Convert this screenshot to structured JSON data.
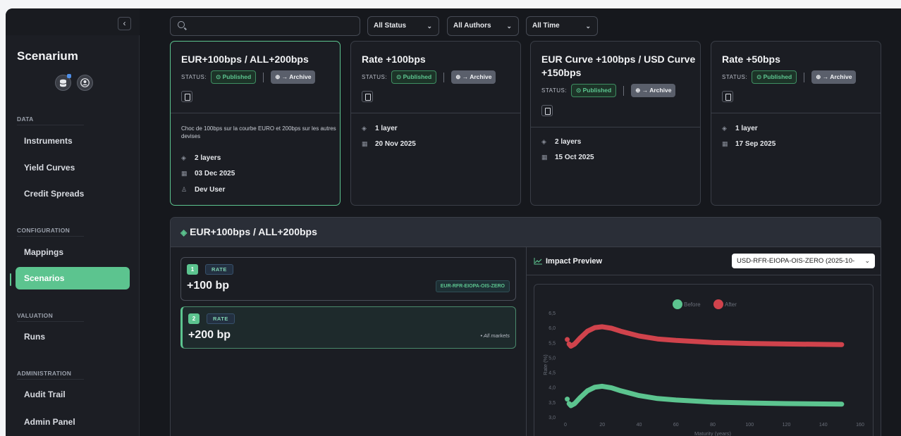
{
  "sidebar": {
    "collapse": "‹",
    "brand": "Scenarium",
    "sections": [
      {
        "title": "DATA",
        "items": [
          "Instruments",
          "Yield Curves",
          "Credit Spreads"
        ]
      },
      {
        "title": "CONFIGURATION",
        "items": [
          "Mappings",
          "Scenarios"
        ]
      },
      {
        "title": "VALUATION",
        "items": [
          "Runs"
        ]
      },
      {
        "title": "ADMINISTRATION",
        "items": [
          "Audit Trail",
          "Admin Panel"
        ]
      }
    ],
    "active_item": "Scenarios"
  },
  "filters": {
    "search_placeholder": "",
    "status": "All Status",
    "authors": "All Authors",
    "time": "All Time"
  },
  "cards": [
    {
      "title": "EUR+100bps / ALL+200bps",
      "status_label": "STATUS:",
      "status": "Published",
      "archive": "→ Archive",
      "description": "Choc de 100bps sur la courbe EURO et 200bps sur les autres devises",
      "layers": "2 layers",
      "date": "03 Dec 2025",
      "author": "Dev User"
    },
    {
      "title": "Rate +100bps",
      "status_label": "STATUS:",
      "status": "Published",
      "archive": "→ Archive",
      "layers": "1 layer",
      "date": "20 Nov 2025"
    },
    {
      "title": "EUR Curve +100bps / USD Curve +150bps",
      "status_label": "STATUS:",
      "status": "Published",
      "archive": "→ Archive",
      "layers": "2 layers",
      "date": "15 Oct 2025"
    },
    {
      "title": "Rate +50bps",
      "status_label": "STATUS:",
      "status": "Published",
      "archive": "→ Archive",
      "layers": "1 layer",
      "date": "17 Sep 2025"
    }
  ],
  "detail": {
    "title": "EUR+100bps / ALL+200bps",
    "layers": [
      {
        "num": "1",
        "type": "RATE",
        "shift": "+100 bp",
        "target": "EUR-RFR-EIOPA-OIS-ZERO"
      },
      {
        "num": "2",
        "type": "RATE",
        "shift": "+200 bp",
        "target": "All markets"
      }
    ],
    "impact": {
      "title": "Impact Preview",
      "selected_curve": "USD-RFR-EIOPA-OIS-ZERO (2025-10-"
    }
  },
  "chart_data": {
    "type": "line",
    "xlabel": "Maturity (years)",
    "ylabel": "Rate (%)",
    "xlim": [
      0,
      160
    ],
    "ylim": [
      3.0,
      6.5
    ],
    "xticks": [
      0,
      20,
      40,
      60,
      80,
      100,
      120,
      140,
      160
    ],
    "yticks": [
      "3,0",
      "3,5",
      "4,0",
      "4,5",
      "5,0",
      "5,5",
      "6,0",
      "6,5"
    ],
    "legend_position": "top-center",
    "series": [
      {
        "name": "Before",
        "color": "#5cc48f",
        "x": [
          1,
          2,
          3,
          5,
          8,
          12,
          16,
          20,
          25,
          30,
          40,
          50,
          60,
          80,
          100,
          120,
          150
        ],
        "y": [
          3.6,
          3.45,
          3.38,
          3.45,
          3.65,
          3.88,
          4.0,
          4.03,
          3.98,
          3.88,
          3.72,
          3.62,
          3.57,
          3.5,
          3.47,
          3.45,
          3.43
        ]
      },
      {
        "name": "After",
        "color": "#d0434c",
        "x": [
          1,
          2,
          3,
          5,
          8,
          12,
          16,
          20,
          25,
          30,
          40,
          50,
          60,
          80,
          100,
          120,
          150
        ],
        "y": [
          5.6,
          5.45,
          5.38,
          5.45,
          5.65,
          5.88,
          6.0,
          6.03,
          5.98,
          5.88,
          5.72,
          5.62,
          5.57,
          5.5,
          5.47,
          5.45,
          5.43
        ]
      }
    ]
  }
}
